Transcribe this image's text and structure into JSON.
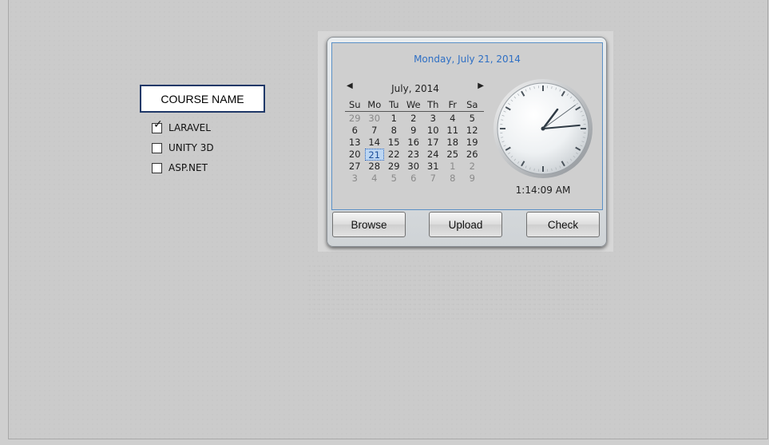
{
  "form": {
    "course_name_label": "COURSE NAME",
    "courses": [
      {
        "label": "LARAVEL",
        "checked": true
      },
      {
        "label": "UNITY 3D",
        "checked": false
      },
      {
        "label": "ASP.NET",
        "checked": false
      }
    ]
  },
  "gadget": {
    "date_title": "Monday, July 21, 2014",
    "calendar": {
      "month_label": "July, 2014",
      "weekdays": [
        "Su",
        "Mo",
        "Tu",
        "We",
        "Th",
        "Fr",
        "Sa"
      ],
      "weeks": [
        [
          {
            "d": "29",
            "o": true
          },
          {
            "d": "30",
            "o": true
          },
          {
            "d": "1"
          },
          {
            "d": "2"
          },
          {
            "d": "3"
          },
          {
            "d": "4"
          },
          {
            "d": "5"
          }
        ],
        [
          {
            "d": "6"
          },
          {
            "d": "7"
          },
          {
            "d": "8"
          },
          {
            "d": "9"
          },
          {
            "d": "10"
          },
          {
            "d": "11"
          },
          {
            "d": "12"
          }
        ],
        [
          {
            "d": "13"
          },
          {
            "d": "14"
          },
          {
            "d": "15"
          },
          {
            "d": "16"
          },
          {
            "d": "17"
          },
          {
            "d": "18"
          },
          {
            "d": "19"
          }
        ],
        [
          {
            "d": "20"
          },
          {
            "d": "21",
            "t": true
          },
          {
            "d": "22"
          },
          {
            "d": "23"
          },
          {
            "d": "24"
          },
          {
            "d": "25"
          },
          {
            "d": "26"
          }
        ],
        [
          {
            "d": "27"
          },
          {
            "d": "28"
          },
          {
            "d": "29"
          },
          {
            "d": "30"
          },
          {
            "d": "31"
          },
          {
            "d": "1",
            "o": true
          },
          {
            "d": "2",
            "o": true
          }
        ],
        [
          {
            "d": "3",
            "o": true
          },
          {
            "d": "4",
            "o": true
          },
          {
            "d": "5",
            "o": true
          },
          {
            "d": "6",
            "o": true
          },
          {
            "d": "7",
            "o": true
          },
          {
            "d": "8",
            "o": true
          },
          {
            "d": "9",
            "o": true
          }
        ]
      ]
    },
    "clock": {
      "time_text": "1:14:09 AM",
      "hour": 1,
      "minute": 14,
      "second": 9
    },
    "buttons": {
      "browse": "Browse",
      "upload": "Upload",
      "check": "Check"
    }
  },
  "colors": {
    "accent_blue": "#2e6fc4",
    "course_border": "#1f3868",
    "background": "#cbcbcb"
  },
  "icons": {
    "prev_month": "triangle-left-icon",
    "next_month": "triangle-right-icon",
    "check_mark": "check-icon"
  }
}
